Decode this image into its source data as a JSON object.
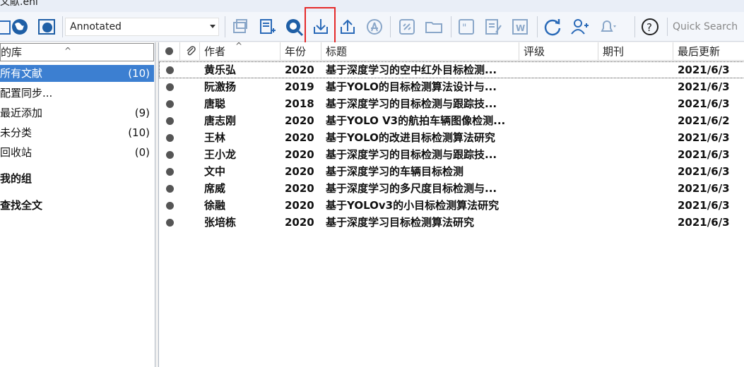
{
  "window": {
    "title": "文献.enl"
  },
  "toolbar": {
    "style": "Annotated",
    "quick_search": "Quick Search"
  },
  "library": {
    "header": "的库",
    "groups": [
      {
        "label": "所有文献",
        "count": "(10)"
      },
      {
        "label": "配置同步...",
        "count": ""
      },
      {
        "label": "最近添加",
        "count": "(9)"
      },
      {
        "label": "未分类",
        "count": "(10)"
      },
      {
        "label": "回收站",
        "count": "(0)"
      }
    ],
    "sections": [
      "我的组",
      "查找全文"
    ]
  },
  "table": {
    "columns": [
      "作者",
      "年份",
      "标题",
      "评级",
      "期刊",
      "最后更新"
    ],
    "rows": [
      {
        "author": "黄乐弘",
        "year": "2020",
        "title": "基于深度学习的空中红外目标检测...",
        "updated": "2021/6/3"
      },
      {
        "author": "阮激扬",
        "year": "2019",
        "title": "基于YOLO的目标检测算法设计与...",
        "updated": "2021/6/3"
      },
      {
        "author": "唐聪",
        "year": "2018",
        "title": "基于深度学习的目标检测与跟踪技...",
        "updated": "2021/6/3"
      },
      {
        "author": "唐志刚",
        "year": "2020",
        "title": "基于YOLO V3的航拍车辆图像检测...",
        "updated": "2021/6/2"
      },
      {
        "author": "王林",
        "year": "2020",
        "title": "基于YOLO的改进目标检测算法研究",
        "updated": "2021/6/3"
      },
      {
        "author": "王小龙",
        "year": "2020",
        "title": "基于深度学习的目标检测与跟踪技...",
        "updated": "2021/6/3"
      },
      {
        "author": "文中",
        "year": "2020",
        "title": "基于深度学习的车辆目标检测",
        "updated": "2021/6/3"
      },
      {
        "author": "席威",
        "year": "2020",
        "title": "基于深度学习的多尺度目标检测与...",
        "updated": "2021/6/3"
      },
      {
        "author": "徐融",
        "year": "2020",
        "title": "基于YOLOv3的小目标检测算法研究",
        "updated": "2021/6/3"
      },
      {
        "author": "张培栋",
        "year": "2020",
        "title": "基于深度学习目标检测算法研究",
        "updated": "2021/6/3"
      }
    ]
  },
  "colors": {
    "accent": "#3c7fd1",
    "icon": "#2a6ab8",
    "highlight": "#e52a2a"
  }
}
